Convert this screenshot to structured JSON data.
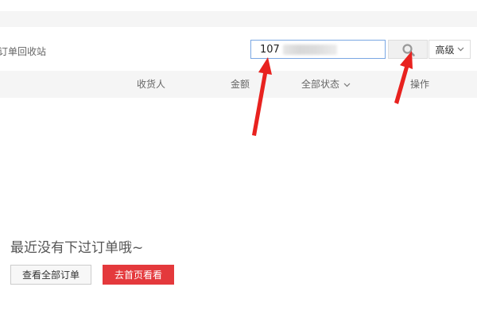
{
  "toolbar": {
    "recycle_bin_label": "订单回收站",
    "search_value": "107",
    "advanced_label": "高级"
  },
  "table_header": {
    "recipient": "收货人",
    "amount": "金额",
    "status": "全部状态",
    "action": "操作"
  },
  "empty_state": {
    "message": "最近没有下过订单哦~",
    "view_all_label": "查看全部订单",
    "go_home_label": "去首页看看"
  },
  "colors": {
    "accent_red": "#e4393c",
    "annotation_red": "#e8221f"
  },
  "icons": {
    "search": "search-icon",
    "advanced_toggle": "chevron-down-icon",
    "status_toggle": "chevron-down-icon"
  }
}
